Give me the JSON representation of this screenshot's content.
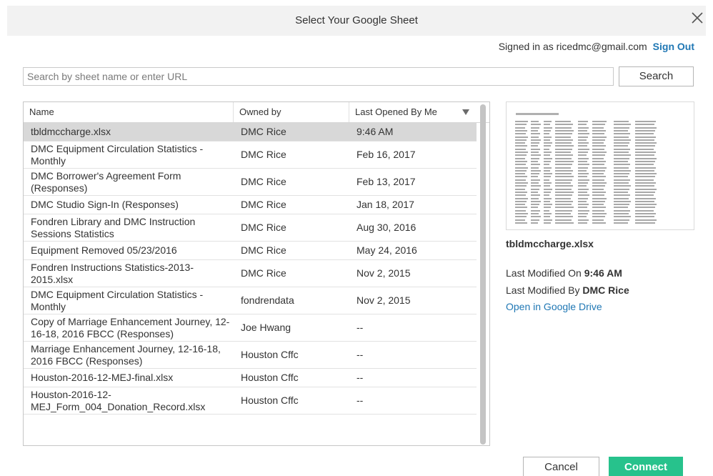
{
  "dialog": {
    "title": "Select Your Google Sheet",
    "close_icon": "close-icon"
  },
  "account": {
    "signed_in_text": "Signed in as ricedmc@gmail.com",
    "sign_out_label": "Sign Out"
  },
  "search": {
    "placeholder": "Search by sheet name or enter URL",
    "value": "",
    "button_label": "Search"
  },
  "table": {
    "columns": [
      "Name",
      "Owned by",
      "Last Opened By Me"
    ],
    "sort_icon": "sort-descending-icon",
    "rows": [
      {
        "name": "tbldmccharge.xlsx",
        "owner": "DMC Rice",
        "last_opened": "9:46 AM"
      },
      {
        "name": "DMC Equipment Circulation Statistics - Monthly",
        "owner": "DMC Rice",
        "last_opened": "Feb 16, 2017"
      },
      {
        "name": "DMC Borrower's Agreement Form (Responses)",
        "owner": "DMC Rice",
        "last_opened": "Feb 13, 2017"
      },
      {
        "name": "DMC Studio Sign-In (Responses)",
        "owner": "DMC Rice",
        "last_opened": "Jan 18, 2017"
      },
      {
        "name": "Fondren Library and DMC Instruction Sessions Statistics",
        "owner": "DMC Rice",
        "last_opened": "Aug 30, 2016"
      },
      {
        "name": "Equipment Removed 05/23/2016",
        "owner": "DMC Rice",
        "last_opened": "May 24, 2016"
      },
      {
        "name": "Fondren Instructions Statistics-2013-2015.xlsx",
        "owner": "DMC Rice",
        "last_opened": "Nov 2, 2015"
      },
      {
        "name": "DMC Equipment Circulation Statistics - Monthly",
        "owner": "fondrendata",
        "last_opened": "Nov 2, 2015"
      },
      {
        "name": "Copy of Marriage Enhancement Journey, 12-16-18, 2016 FBCC (Responses)",
        "owner": "Joe Hwang",
        "last_opened": "--"
      },
      {
        "name": "Marriage Enhancement Journey, 12-16-18, 2016 FBCC (Responses)",
        "owner": "Houston Cffc",
        "last_opened": "--"
      },
      {
        "name": "Houston-2016-12-MEJ-final.xlsx",
        "owner": "Houston Cffc",
        "last_opened": "--"
      },
      {
        "name": "Houston-2016-12-MEJ_Form_004_Donation_Record.xlsx",
        "owner": "Houston Cffc",
        "last_opened": "--"
      }
    ]
  },
  "details": {
    "file_name": "tbldmccharge.xlsx",
    "modified_on_label": "Last Modified On",
    "modified_on_value": "9:46 AM",
    "modified_by_label": "Last Modified By",
    "modified_by_value": "DMC Rice",
    "open_link": "Open in Google Drive"
  },
  "footer": {
    "cancel_label": "Cancel",
    "connect_label": "Connect"
  },
  "colors": {
    "accent": "#27c28c",
    "link": "#1f77b4",
    "selected_row": "#d8d8d8"
  }
}
